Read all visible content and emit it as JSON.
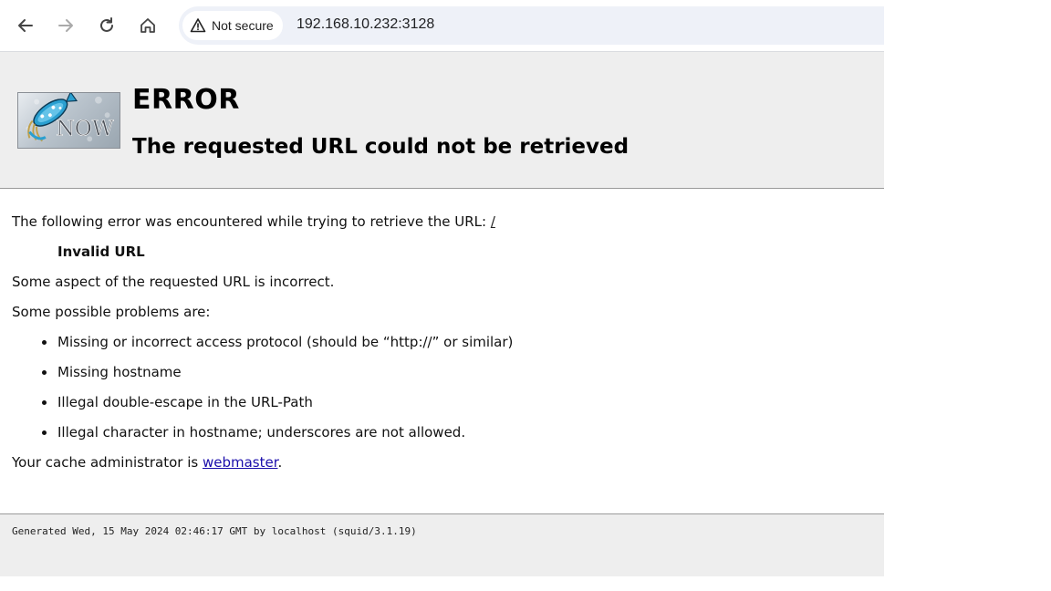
{
  "browser": {
    "security_label": "Not secure",
    "url": "192.168.10.232:3128",
    "icons": [
      "back-icon",
      "forward-icon",
      "reload-icon",
      "home-icon",
      "warning-icon"
    ]
  },
  "page": {
    "logo_text": "NOW",
    "title": "ERROR",
    "subtitle": "The requested URL could not be retrieved",
    "intro": "The following error was encountered while trying to retrieve the URL: ",
    "url_link": "/",
    "error_name": "Invalid URL",
    "description": "Some aspect of the requested URL is incorrect.",
    "problems_heading": "Some possible problems are:",
    "problems": [
      "Missing or incorrect access protocol (should be “http://” or similar)",
      "Missing hostname",
      "Illegal double-escape in the URL-Path",
      "Illegal character in hostname; underscores are not allowed."
    ],
    "admin_prefix": "Your cache administrator is ",
    "admin_link": "webmaster",
    "admin_suffix": ".",
    "footer": "Generated Wed, 15 May 2024 02:46:17 GMT by localhost (squid/3.1.19)"
  }
}
